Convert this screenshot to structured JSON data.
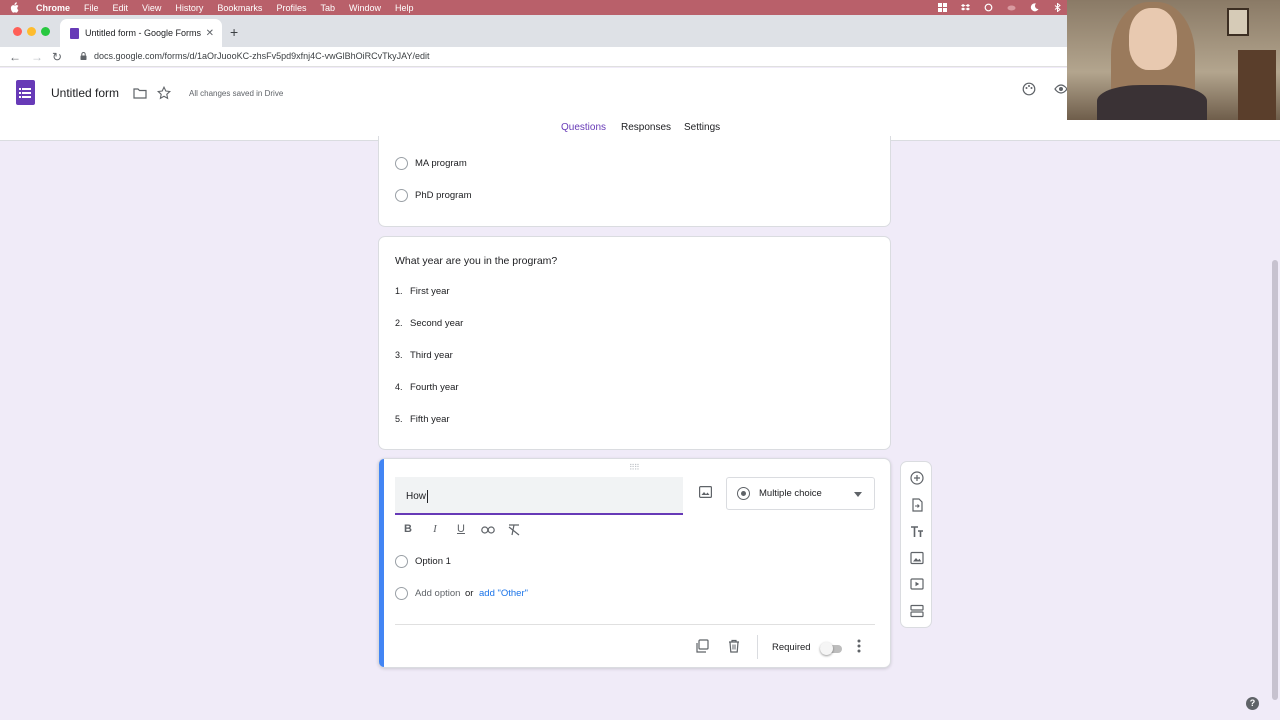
{
  "menubar": {
    "items": [
      "Chrome",
      "File",
      "Edit",
      "View",
      "History",
      "Bookmarks",
      "Profiles",
      "Tab",
      "Window",
      "Help"
    ]
  },
  "browser": {
    "tab_title": "Untitled form - Google Forms",
    "url": "docs.google.com/forms/d/1aOrJuooKC-zhsFv5pd9xfnj4C-vwGlBhOiRCvTkyJAY/edit"
  },
  "header": {
    "form_title": "Untitled form",
    "save_status": "All changes saved in Drive",
    "tabs": [
      "Questions",
      "Responses",
      "Settings"
    ],
    "active_tab": "Questions"
  },
  "card_program": {
    "options": [
      "MA program",
      "PhD program"
    ]
  },
  "card_year": {
    "question": "What year are you in the program?",
    "items": [
      {
        "num": "1.",
        "label": "First year"
      },
      {
        "num": "2.",
        "label": "Second year"
      },
      {
        "num": "3.",
        "label": "Third year"
      },
      {
        "num": "4.",
        "label": "Fourth year"
      },
      {
        "num": "5.",
        "label": "Fifth year"
      }
    ]
  },
  "active_card": {
    "question_text": "How",
    "question_type": "Multiple choice",
    "option_1": "Option 1",
    "add_option": "Add option",
    "or_text": "or",
    "add_other": "add \"Other\"",
    "required_label": "Required",
    "required_on": false,
    "accent_color": "#4285f4"
  },
  "theme": {
    "primary": "#673ab7",
    "background": "#f0ebf8"
  }
}
